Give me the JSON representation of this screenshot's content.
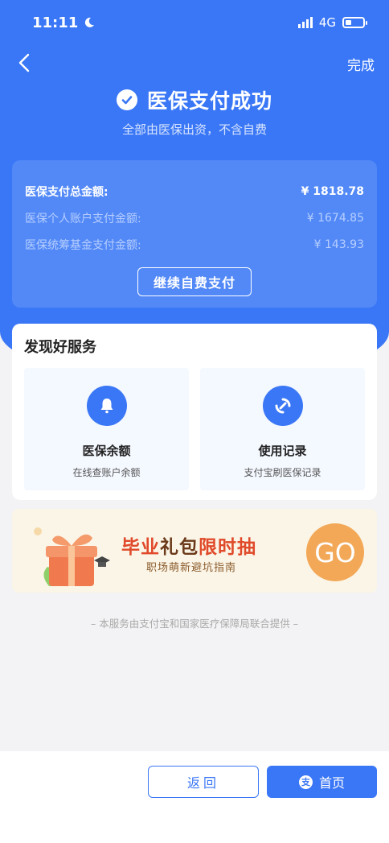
{
  "status_bar": {
    "time": "11:11",
    "network": "4G"
  },
  "header": {
    "done_label": "完成",
    "title": "医保支付成功",
    "subtitle": "全部由医保出资，不含自费"
  },
  "summary": {
    "total_label": "医保支付总金额:",
    "total_value": "¥ 1818.78",
    "personal_label": "医保个人账户支付金额:",
    "personal_value": "¥ 1674.85",
    "pool_label": "医保统筹基金支付金额:",
    "pool_value": "¥ 143.93",
    "continue_label": "继续自费支付"
  },
  "services": {
    "heading": "发现好服务",
    "items": [
      {
        "name": "医保余额",
        "desc": "在线查账户余额",
        "icon": "bell-icon"
      },
      {
        "name": "使用记录",
        "desc": "支付宝刷医保记录",
        "icon": "record-icon"
      }
    ]
  },
  "banner": {
    "title_red_1": "毕业",
    "title_dark": "礼包",
    "title_red_2": "限时抽",
    "subtitle": "职场萌新避坑指南",
    "go_label": "GO"
  },
  "footer_note": "– 本服务由支付宝和国家医疗保障局联合提供 –",
  "bottom": {
    "back_label": "返回",
    "home_label": "首页",
    "home_icon_glyph": "支"
  },
  "colors": {
    "primary": "#3a77f6",
    "go": "#f2a857",
    "banner_red": "#e04a2a"
  }
}
